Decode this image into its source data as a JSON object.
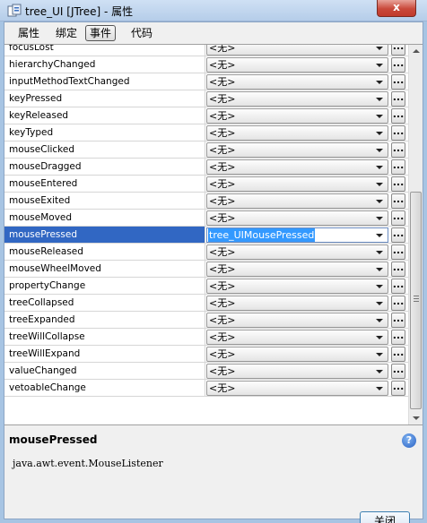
{
  "window": {
    "title": "tree_UI [JTree] - 属性",
    "close_glyph": "x"
  },
  "tabs": [
    {
      "label": "属性"
    },
    {
      "label": "绑定"
    },
    {
      "label": "事件",
      "active": true
    },
    {
      "label": "代码"
    }
  ],
  "properties": [
    {
      "name": "focusLost",
      "value": "<无>"
    },
    {
      "name": "hierarchyChanged",
      "value": "<无>"
    },
    {
      "name": "inputMethodTextChanged",
      "value": "<无>"
    },
    {
      "name": "keyPressed",
      "value": "<无>"
    },
    {
      "name": "keyReleased",
      "value": "<无>"
    },
    {
      "name": "keyTyped",
      "value": "<无>"
    },
    {
      "name": "mouseClicked",
      "value": "<无>"
    },
    {
      "name": "mouseDragged",
      "value": "<无>"
    },
    {
      "name": "mouseEntered",
      "value": "<无>"
    },
    {
      "name": "mouseExited",
      "value": "<无>"
    },
    {
      "name": "mouseMoved",
      "value": "<无>"
    },
    {
      "name": "mousePressed",
      "value": "tree_UIMousePressed",
      "selected": true
    },
    {
      "name": "mouseReleased",
      "value": "<无>"
    },
    {
      "name": "mouseWheelMoved",
      "value": "<无>"
    },
    {
      "name": "propertyChange",
      "value": "<无>"
    },
    {
      "name": "treeCollapsed",
      "value": "<无>"
    },
    {
      "name": "treeExpanded",
      "value": "<无>"
    },
    {
      "name": "treeWillCollapse",
      "value": "<无>"
    },
    {
      "name": "treeWillExpand",
      "value": "<无>"
    },
    {
      "name": "valueChanged",
      "value": "<无>"
    },
    {
      "name": "vetoableChange",
      "value": "<无>"
    }
  ],
  "ellipsis_label": "...",
  "description": {
    "title": "mousePressed",
    "text": "java.awt.event.MouseListener",
    "help_glyph": "?"
  },
  "close_button_label": "关闭",
  "colors": {
    "selection": "#3167c3",
    "edit_highlight": "#3399ff"
  }
}
